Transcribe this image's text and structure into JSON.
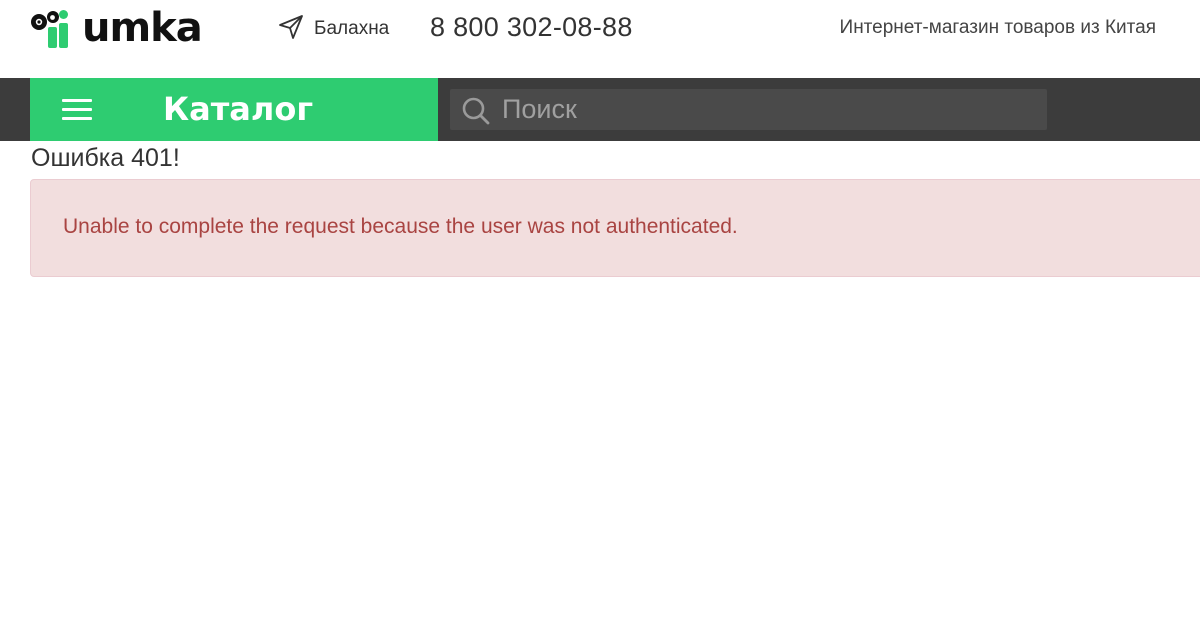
{
  "header": {
    "logo_text": "umka",
    "city": "Балахна",
    "phone": "8 800 302-08-88",
    "tagline": "Интернет-магазин товаров из Китая",
    "brand_color": "#2ecc71"
  },
  "navbar": {
    "catalog_label": "Каталог",
    "search_placeholder": "Поиск",
    "background_color": "#3c3c3c"
  },
  "content": {
    "error_title": "Ошибка 401!",
    "error_message": "Unable to complete the request because the user was not authenticated.",
    "alert_background": "#f2dede",
    "alert_text_color": "#a94442"
  }
}
